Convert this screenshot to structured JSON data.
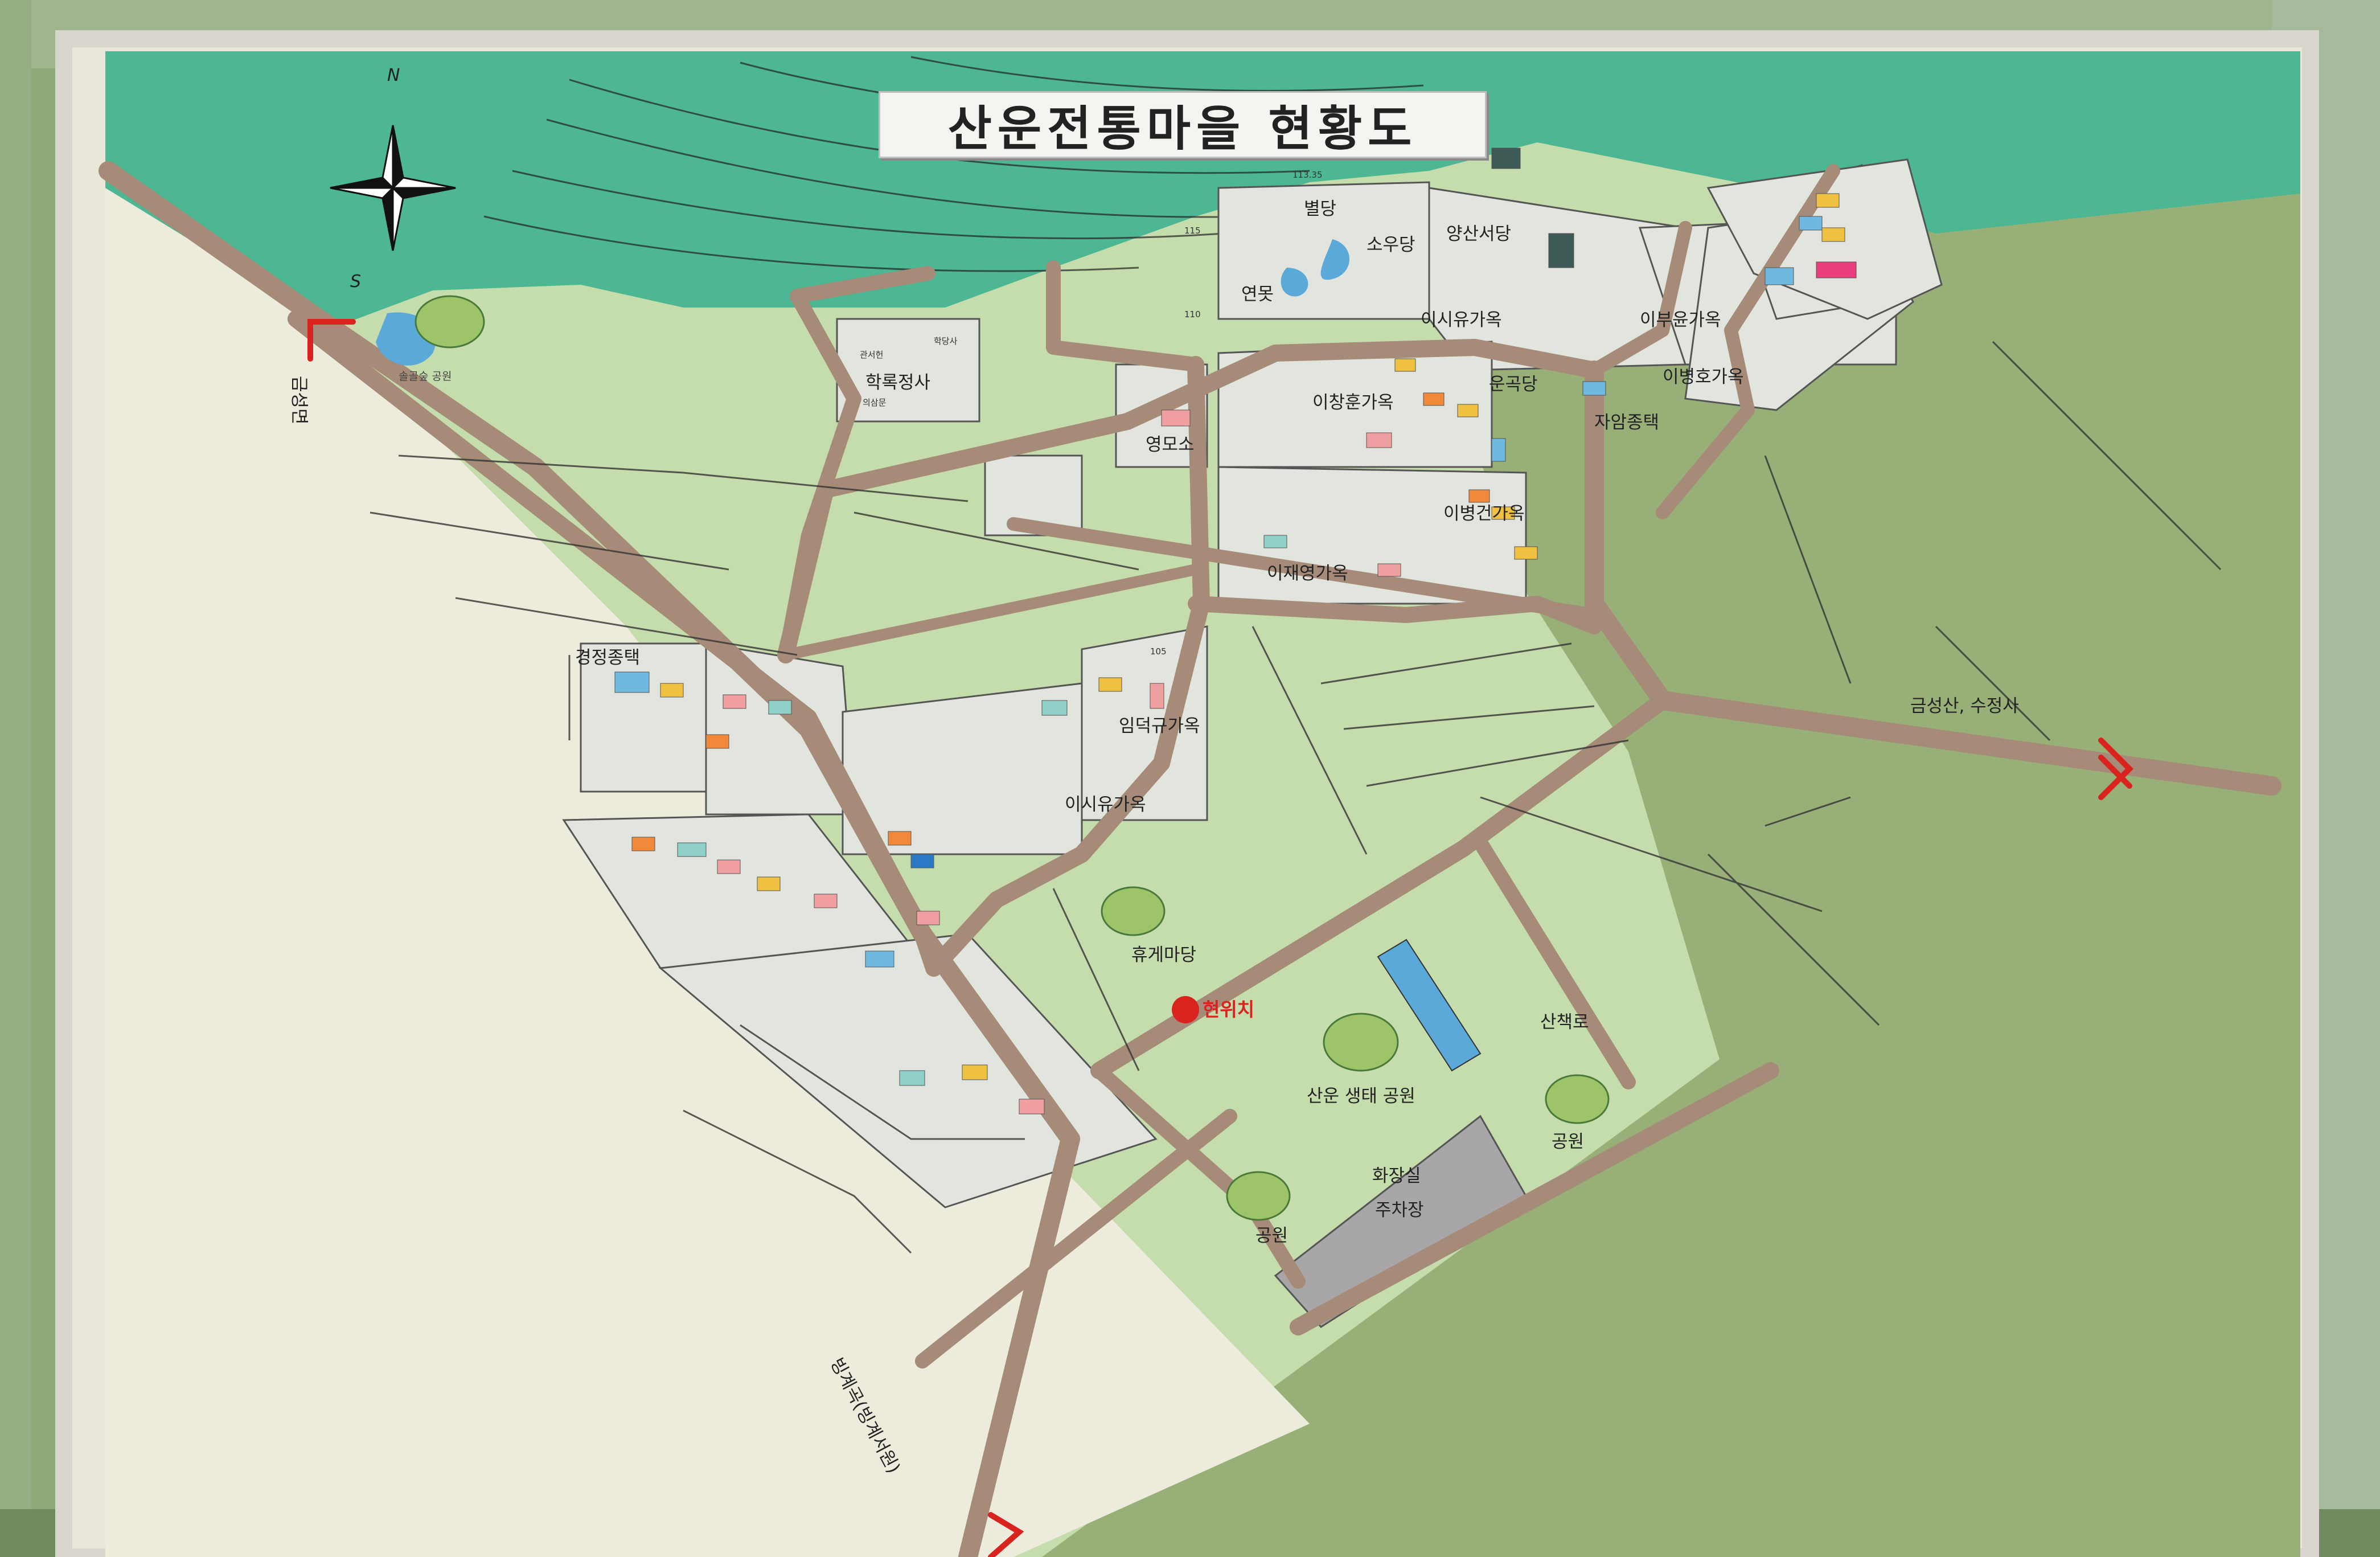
{
  "title": "산운전통마을 현황도",
  "compass": {
    "north": "N",
    "south": "S"
  },
  "current_location": "현위치",
  "colors": {
    "river": "#4db693",
    "field_light": "#c5dcac",
    "field_dark": "#98b078",
    "road": "#a58b78",
    "house_lot": "#e2e4de",
    "marker": "#d9231e"
  },
  "places": {
    "songgol_park": "솔골숲 공원",
    "hakrokjeongsa": "학록정사",
    "gwanseohyeon": "관서헌",
    "hakdangsa": "학당사",
    "dukdamun": "의삼문",
    "byeoldang": "별당",
    "sowoodang": "소우당",
    "yeonmot": "연못",
    "yangsanseodang": "양산서당",
    "isiyu_house_1": "이시유가옥",
    "yunggokdang": "운곡당",
    "ibuyun_house": "이부윤가옥",
    "ibyeongho_house": "이병호가옥",
    "jaamjongtaek": "자암종택",
    "ichanghun_house": "이창훈가옥",
    "yeongmoso": "영모소",
    "ibyeonggeon_house": "이병건가옥",
    "ijaeyeong_house": "이재영가옥",
    "gyeongjeong_jongtaek": "경정종택",
    "imdeokgyu_house": "임덕규가옥",
    "isiyu_house_2": "이시유가옥",
    "hyuge_madang": "휴게마당",
    "sanchaekro": "산책로",
    "eco_park": "산운 생태 공원",
    "park_1": "공원",
    "park_2": "공원",
    "restroom": "화장실",
    "parking": "주차장",
    "to_geumseong": "금성면",
    "to_geumseongsan": "금성산, 수정사",
    "to_bingye": "빙계곡(빙계서원)"
  },
  "contours": [
    "113.35",
    "115",
    "110",
    "105"
  ]
}
